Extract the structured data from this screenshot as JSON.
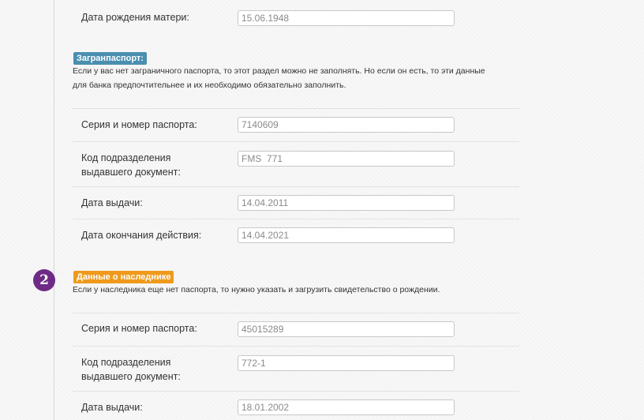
{
  "top_section": {
    "mother_birth_date": {
      "label": "Дата рождения матери:",
      "value": "15.06.1948"
    }
  },
  "foreign_passport": {
    "badge": "Загранпаспорт:",
    "note_line1": "Если у вас нет заграничного паспорта, то этот раздел можно не заполнять. Но если он есть, то эти данные",
    "note_line2": "для банка предпочтительнее и их необходимо обязательно заполнить.",
    "series_number": {
      "label": "Серия и номер паспорта:",
      "value": "7140609"
    },
    "division_code": {
      "label": "Код подразделения\nвыдавшего документ:",
      "value": "FMS  771"
    },
    "issue_date": {
      "label": "Дата выдачи:",
      "value": "14.04.2011"
    },
    "expiry_date": {
      "label": "Дата окончания действия:",
      "value": "14.04.2021"
    }
  },
  "heir_section": {
    "step_number": "2",
    "badge": "Данные о наследнике",
    "note": "Если у наследника еще нет паспорта, то нужно указать и загрузить свидетельство о рождении.",
    "series_number": {
      "label": "Серия и номер паспорта:",
      "value": "45015289"
    },
    "division_code": {
      "label": "Код подразделения\nвыдавшего документ:",
      "value": "772-1"
    },
    "issue_date": {
      "label": "Дата выдачи:",
      "value": "18.01.2002"
    }
  },
  "colors": {
    "foreign_badge": "#4a8fb0",
    "heir_badge": "#ef9a1c",
    "step_circle": "#6d2b86"
  }
}
